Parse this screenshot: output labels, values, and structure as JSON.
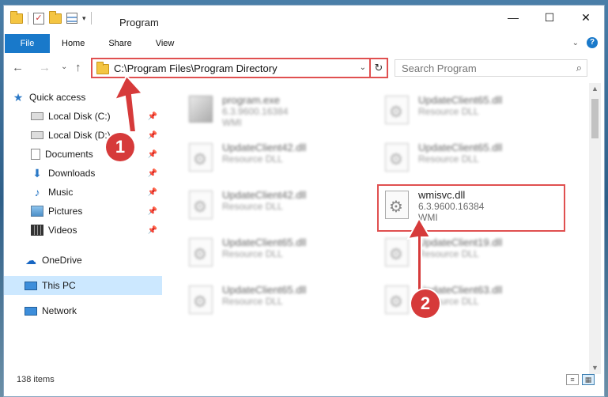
{
  "window": {
    "title": "Program",
    "controls": {
      "minimize": "—",
      "maximize": "☐",
      "close": "✕"
    }
  },
  "ribbon": {
    "tabs": [
      "File",
      "Home",
      "Share",
      "View"
    ],
    "help_label": "?"
  },
  "address": {
    "path": "C:\\Program Files\\Program Directory",
    "refresh_glyph": "↻",
    "dropdown_glyph": "⌄"
  },
  "search": {
    "placeholder": "Search Program",
    "icon_glyph": "⌕"
  },
  "nav": {
    "back": "←",
    "forward": "→",
    "recent": "⌄",
    "up": "↑"
  },
  "sidebar": {
    "pin_glyph": "📌",
    "items": [
      {
        "label": "Quick access",
        "icon": "star-icon",
        "pinned": false
      },
      {
        "label": "Local Disk (C:)",
        "icon": "disk-icon",
        "pinned": true
      },
      {
        "label": "Local Disk (D:)",
        "icon": "disk-icon",
        "pinned": true
      },
      {
        "label": "Documents",
        "icon": "documents-icon",
        "pinned": true
      },
      {
        "label": "Downloads",
        "icon": "downloads-icon",
        "pinned": true
      },
      {
        "label": "Music",
        "icon": "music-icon",
        "pinned": true
      },
      {
        "label": "Pictures",
        "icon": "pictures-icon",
        "pinned": true
      },
      {
        "label": "Videos",
        "icon": "videos-icon",
        "pinned": true
      },
      {
        "label": "OneDrive",
        "icon": "onedrive-icon",
        "pinned": false
      },
      {
        "label": "This PC",
        "icon": "this-pc-icon",
        "pinned": false,
        "selected": true
      },
      {
        "label": "Network",
        "icon": "network-icon",
        "pinned": false
      }
    ]
  },
  "files": [
    {
      "name": "program.exe",
      "line2": "6.3.9600.16384",
      "line3": "WMI",
      "type": "exe",
      "blurred": true
    },
    {
      "name": "UpdateClient65.dll",
      "line2": "Resource DLL",
      "line3": "",
      "type": "dll",
      "blurred": true
    },
    {
      "name": "UpdateClient42.dll",
      "line2": "Resource DLL",
      "line3": "",
      "type": "dll",
      "blurred": true
    },
    {
      "name": "UpdateClient65.dll",
      "line2": "Resource DLL",
      "line3": "",
      "type": "dll",
      "blurred": true
    },
    {
      "name": "UpdateClient42.dll",
      "line2": "Resource DLL",
      "line3": "",
      "type": "dll",
      "blurred": true
    },
    {
      "name": "wmisvc.dll",
      "line2": "6.3.9600.16384",
      "line3": "WMI",
      "type": "dll",
      "blurred": false,
      "highlighted": true
    },
    {
      "name": "UpdateClient65.dll",
      "line2": "Resource DLL",
      "line3": "",
      "type": "dll",
      "blurred": true
    },
    {
      "name": "UpdateClient19.dll",
      "line2": "Resource DLL",
      "line3": "",
      "type": "dll",
      "blurred": true
    },
    {
      "name": "UpdateClient65.dll",
      "line2": "Resource DLL",
      "line3": "",
      "type": "dll",
      "blurred": true
    },
    {
      "name": "UpdateClient63.dll",
      "line2": "Resource DLL",
      "line3": "",
      "type": "dll",
      "blurred": true
    }
  ],
  "status": {
    "item_count": "138 items"
  },
  "annotations": {
    "step1": "1",
    "step2": "2",
    "color": "#d63a3a"
  },
  "colors": {
    "accent": "#1979ca",
    "highlight": "#e05050",
    "selected": "#cce8ff"
  }
}
